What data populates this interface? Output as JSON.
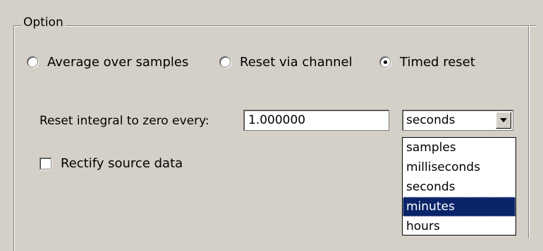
{
  "group": {
    "title": "Option"
  },
  "mode": {
    "options": [
      {
        "label": "Average over samples",
        "selected": false
      },
      {
        "label": "Reset via channel",
        "selected": false
      },
      {
        "label": "Timed reset",
        "selected": true
      }
    ]
  },
  "reset": {
    "label": "Reset integral to zero every:",
    "value": "1.000000",
    "unit_selected": "seconds",
    "unit_options": [
      "samples",
      "milliseconds",
      "seconds",
      "minutes",
      "hours"
    ],
    "highlighted_option": "minutes"
  },
  "rectify": {
    "label": "Rectify source data",
    "checked": false
  },
  "icons": {
    "dropdown_arrow": "chevron-down-icon"
  },
  "colors": {
    "background": "#d4d0c8",
    "selection": "#0a246a"
  }
}
